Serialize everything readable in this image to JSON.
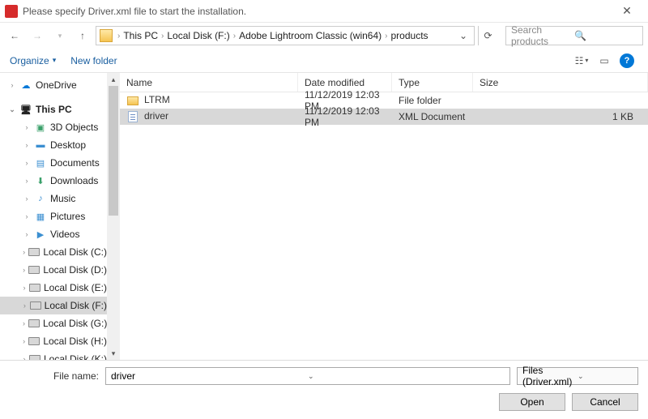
{
  "title": "Please specify Driver.xml file to start the installation.",
  "breadcrumb": [
    "This PC",
    "Local Disk (F:)",
    "Adobe Lightroom Classic (win64)",
    "products"
  ],
  "search_placeholder": "Search products",
  "toolbar": {
    "organize": "Organize",
    "newfolder": "New folder"
  },
  "columns": {
    "name": "Name",
    "date": "Date modified",
    "type": "Type",
    "size": "Size"
  },
  "files": [
    {
      "name": "LTRM",
      "date": "11/12/2019 12:03 PM",
      "type": "File folder",
      "size": "",
      "icon": "folder",
      "selected": false
    },
    {
      "name": "driver",
      "date": "11/12/2019 12:03 PM",
      "type": "XML Document",
      "size": "1 KB",
      "icon": "xml",
      "selected": true
    }
  ],
  "tree": {
    "onedrive": "OneDrive",
    "thispc": "This PC",
    "children": [
      "3D Objects",
      "Desktop",
      "Documents",
      "Downloads",
      "Music",
      "Pictures",
      "Videos",
      "Local Disk (C:)",
      "Local Disk (D:)",
      "Local Disk (E:)",
      "Local Disk (F:)",
      "Local Disk (G:)",
      "Local Disk (H:)",
      "Local Disk (K:)"
    ],
    "selected": "Local Disk (F:)"
  },
  "footer": {
    "filename_label": "File name:",
    "filename_value": "driver",
    "filetype": "Files (Driver.xml)",
    "open": "Open",
    "cancel": "Cancel"
  }
}
